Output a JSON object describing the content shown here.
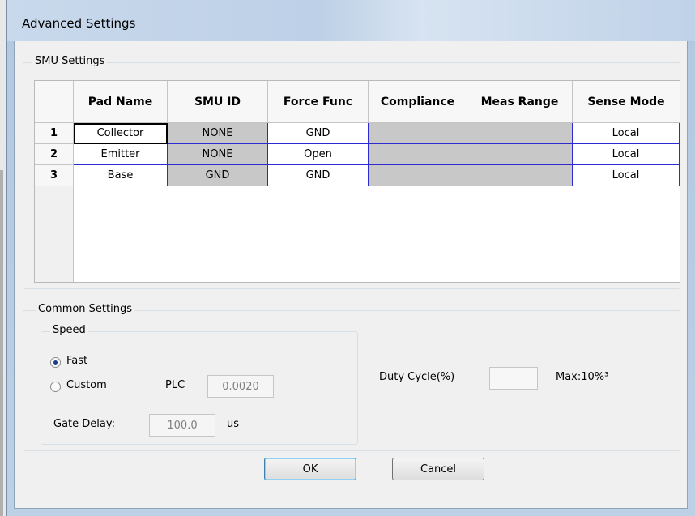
{
  "window": {
    "title": "Advanced Settings"
  },
  "smu_settings": {
    "label": "SMU Settings",
    "columns": [
      "Pad Name",
      "SMU  ID",
      "Force Func",
      "Compliance",
      "Meas Range",
      "Sense Mode"
    ],
    "rows": [
      {
        "num": "1",
        "pad_name": "Collector",
        "smu_id": "NONE",
        "force_func": "GND",
        "compliance": "",
        "meas_range": "",
        "sense_mode": "Local"
      },
      {
        "num": "2",
        "pad_name": "Emitter",
        "smu_id": "NONE",
        "force_func": "Open",
        "compliance": "",
        "meas_range": "",
        "sense_mode": "Local"
      },
      {
        "num": "3",
        "pad_name": "Base",
        "smu_id": "GND",
        "force_func": "GND",
        "compliance": "",
        "meas_range": "",
        "sense_mode": "Local"
      }
    ]
  },
  "common_settings": {
    "label": "Common Settings",
    "speed": {
      "label": "Speed",
      "fast_label": "Fast",
      "custom_label": "Custom",
      "selected": "Fast",
      "plc_label": "PLC",
      "plc_value": "0.0020",
      "gate_delay_label": "Gate Delay:",
      "gate_delay_value": "100.0",
      "gate_delay_unit": "us"
    },
    "duty_cycle_label": "Duty Cycle(%)",
    "duty_cycle_value": "",
    "max_label": "Max:10%³"
  },
  "buttons": {
    "ok": "OK",
    "cancel": "Cancel"
  },
  "colors": {
    "grid_border": "#2b2bd0",
    "disabled_cell": "#c8c8c8",
    "frame": "#b3c9e1"
  }
}
